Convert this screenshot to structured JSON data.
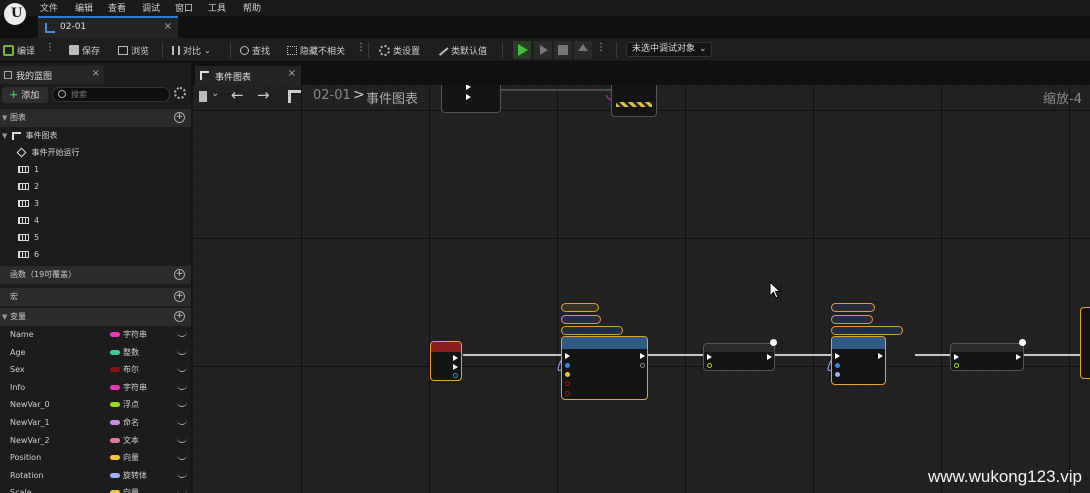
{
  "menu": {
    "logo": "U",
    "items": [
      "文件",
      "编辑",
      "查看",
      "调试",
      "窗口",
      "工具",
      "帮助"
    ]
  },
  "document_tab": {
    "label": "02-01",
    "close": "×"
  },
  "toolbar": {
    "compile": "编译",
    "save": "保存",
    "browse": "浏览",
    "diff": "对比",
    "find": "查找",
    "hide_unrelated": "隐藏不相关",
    "class_settings": "类设置",
    "class_defaults": "类默认值",
    "debug_object": "未选中调试对象"
  },
  "my_blueprint": {
    "tab_label": "我的蓝图",
    "close": "×",
    "add_label": "添加",
    "search_placeholder": "搜索",
    "graphs_header": "图表",
    "event_graph": "事件图表",
    "begin_play": "事件开始运行",
    "macros": [
      "1",
      "2",
      "3",
      "4",
      "5",
      "6"
    ],
    "functions_header": "函数（19可覆盖）",
    "macros_header": "宏",
    "variables_header": "变量",
    "variables": [
      {
        "name": "Name",
        "type": "字符串",
        "color": "#e83ab8"
      },
      {
        "name": "Age",
        "type": "整数",
        "color": "#3ec993"
      },
      {
        "name": "Sex",
        "type": "布尔",
        "color": "#8c1313"
      },
      {
        "name": "Info",
        "type": "字符串",
        "color": "#e83ab8"
      },
      {
        "name": "NewVar_0",
        "type": "浮点",
        "color": "#9bd91a"
      },
      {
        "name": "NewVar_1",
        "type": "命名",
        "color": "#c98ae6"
      },
      {
        "name": "NewVar_2",
        "type": "文本",
        "color": "#e27aa0"
      },
      {
        "name": "Position",
        "type": "向量",
        "color": "#f2c23c"
      },
      {
        "name": "Rotation",
        "type": "旋转体",
        "color": "#9cb2f2"
      },
      {
        "name": "Scale",
        "type": "向量",
        "color": "#f2c23c"
      }
    ]
  },
  "graph": {
    "tab_label": "事件图表",
    "close": "×",
    "breadcrumb_root": "02-01",
    "breadcrumb_sep": ">",
    "breadcrumb_leaf": "事件图表",
    "zoom": "缩放-4",
    "watermark": "www.wukong123.vip"
  }
}
